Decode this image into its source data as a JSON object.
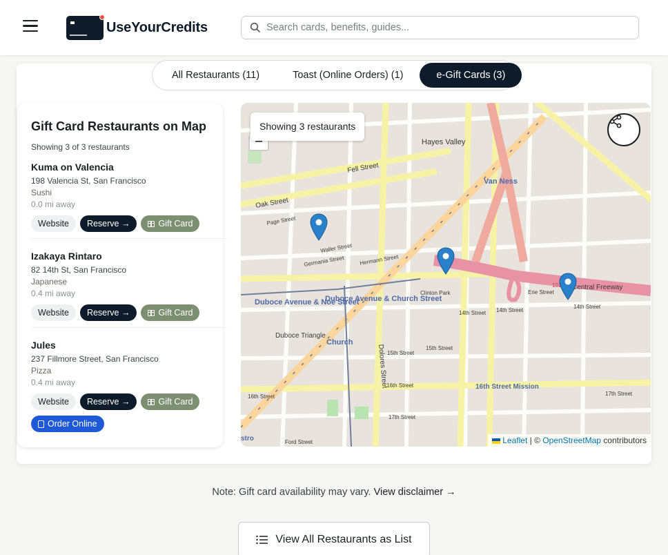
{
  "header": {
    "brand": "UseYourCredits",
    "search_placeholder": "Search cards, benefits, guides..."
  },
  "tabs": [
    {
      "label": "All Restaurants (11)",
      "active": false
    },
    {
      "label": "Toast (Online Orders) (1)",
      "active": false
    },
    {
      "label": "e-Gift Cards (3)",
      "active": true
    }
  ],
  "list": {
    "title": "Gift Card Restaurants on Map",
    "count": "Showing 3 of 3 restaurants",
    "website_label": "Website",
    "reserve_label": "Reserve →",
    "gift_label": "Gift Card",
    "order_label": "Order Online",
    "items": [
      {
        "name": "Kuma on Valencia",
        "address": "198 Valencia St, San Francisco",
        "cuisine": "Sushi",
        "distance": "0.0 mi away"
      },
      {
        "name": "Izakaya Rintaro",
        "address": "82 14th St, San Francisco",
        "cuisine": "Japanese",
        "distance": "0.4 mi away"
      },
      {
        "name": "Jules",
        "address": "237 Fillmore Street, San Francisco",
        "cuisine": "Pizza",
        "distance": "0.4 mi away"
      }
    ]
  },
  "map": {
    "badge": "Showing 3 restaurants",
    "zoom_out": "−",
    "attribution_leaflet": "Leaflet",
    "attribution_sep": " | © ",
    "attribution_osm": "OpenStreetMap",
    "attribution_tail": " contributors",
    "labels": {
      "hayes_valley": "Hayes Valley",
      "van_ness": "Van Ness",
      "fell": "Fell Street",
      "oak": "Oak Street",
      "page": "Page Street",
      "waller": "Waller Street",
      "germania": "Germania Street",
      "hermann": "Hermann Street",
      "duboce_church": "Duboce Avenue & Church Street",
      "church": "Church",
      "duboce_noe": "Duboce Avenue & Noe Street",
      "duboce_triangle": "Duboce Triangle",
      "dolores": "Dolores Street",
      "clinton_park": "Clinton Park",
      "fourteenth": "14th Street",
      "fifteenth": "15th Street",
      "sixteenth": "16th Street",
      "seventeenth": "17th Street",
      "sixteenth_mission": "16th Street Mission",
      "central_freeway": "Central Freeway",
      "erie": "Erie Street",
      "ford": "Ford Street",
      "castro_stub": "stro",
      "hwy": "101"
    }
  },
  "footer": {
    "note": "Note: Gift card availability may vary.",
    "disclaimer": "View disclaimer →",
    "view_all": "View All Restaurants as List"
  },
  "colors": {
    "navy": "#0d1b2a",
    "gift_green": "#7d8f71",
    "order_blue": "#1e5ad7",
    "marker_blue": "#2a81cb"
  }
}
